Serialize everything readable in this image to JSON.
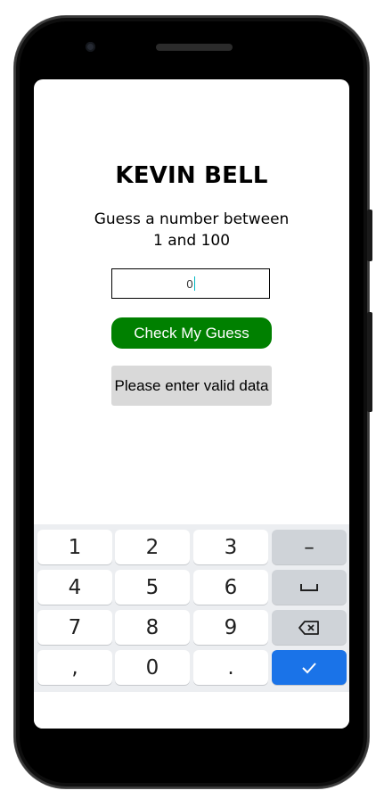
{
  "app": {
    "title": "KEVIN BELL",
    "prompt": "Guess a number between 1 and 100",
    "input_value": "0",
    "check_button_label": "Check My Guess",
    "message": "Please enter valid data"
  },
  "keyboard": {
    "rows": [
      [
        {
          "label": "1"
        },
        {
          "label": "2"
        },
        {
          "label": "3"
        },
        {
          "label": "–",
          "icon": "minus-icon"
        }
      ],
      [
        {
          "label": "4"
        },
        {
          "label": "5"
        },
        {
          "label": "6"
        },
        {
          "label": "␣",
          "icon": "space-icon"
        }
      ],
      [
        {
          "label": "7"
        },
        {
          "label": "8"
        },
        {
          "label": "9"
        },
        {
          "label": "⌫",
          "icon": "backspace-icon"
        }
      ],
      [
        {
          "label": ","
        },
        {
          "label": "0"
        },
        {
          "label": "."
        },
        {
          "label": "✓",
          "icon": "check-icon"
        }
      ]
    ]
  },
  "colors": {
    "check_button": "#008000",
    "message_bg": "#d9d9d9",
    "done_key": "#1a73e8",
    "function_key": "#cfd3d8"
  }
}
